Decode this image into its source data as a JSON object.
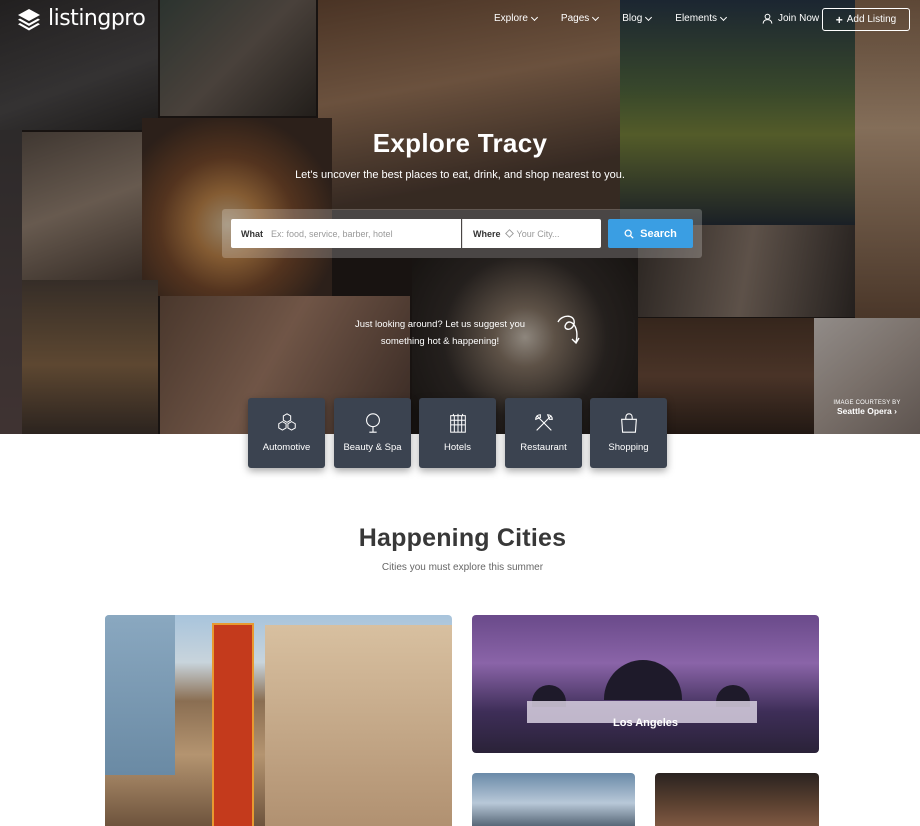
{
  "brand": {
    "name": "listingpro"
  },
  "nav": {
    "items": [
      {
        "label": "Explore"
      },
      {
        "label": "Pages"
      },
      {
        "label": "Blog"
      },
      {
        "label": "Elements"
      }
    ],
    "join_label": "Join Now",
    "add_listing_label": "Add Listing"
  },
  "hero": {
    "title": "Explore Tracy",
    "subtitle": "Let's uncover the best places to eat, drink, and shop nearest to you.",
    "suggest_line1": "Just looking around? Let us suggest you",
    "suggest_line2": "something hot & happening!",
    "credit_small": "IMAGE COURTESY BY",
    "credit_big": "Seattle Opera"
  },
  "search": {
    "what_label": "What",
    "what_placeholder": "Ex: food, service, barber, hotel",
    "where_label": "Where",
    "where_placeholder": "Your City...",
    "button_label": "Search",
    "button_color": "#3a9ee3"
  },
  "categories": [
    {
      "label": "Automotive",
      "icon": "hexagons-icon"
    },
    {
      "label": "Beauty & Spa",
      "icon": "mirror-icon"
    },
    {
      "label": "Hotels",
      "icon": "building-icon"
    },
    {
      "label": "Restaurant",
      "icon": "fork-knife-icon"
    },
    {
      "label": "Shopping",
      "icon": "shopping-bag-icon"
    }
  ],
  "section": {
    "title": "Happening Cities",
    "subtitle": "Cities you must explore this summer"
  },
  "cities": [
    {
      "name": "Los Angeles"
    }
  ],
  "colors": {
    "category_tile": "#3b4350",
    "heading": "#383838"
  }
}
